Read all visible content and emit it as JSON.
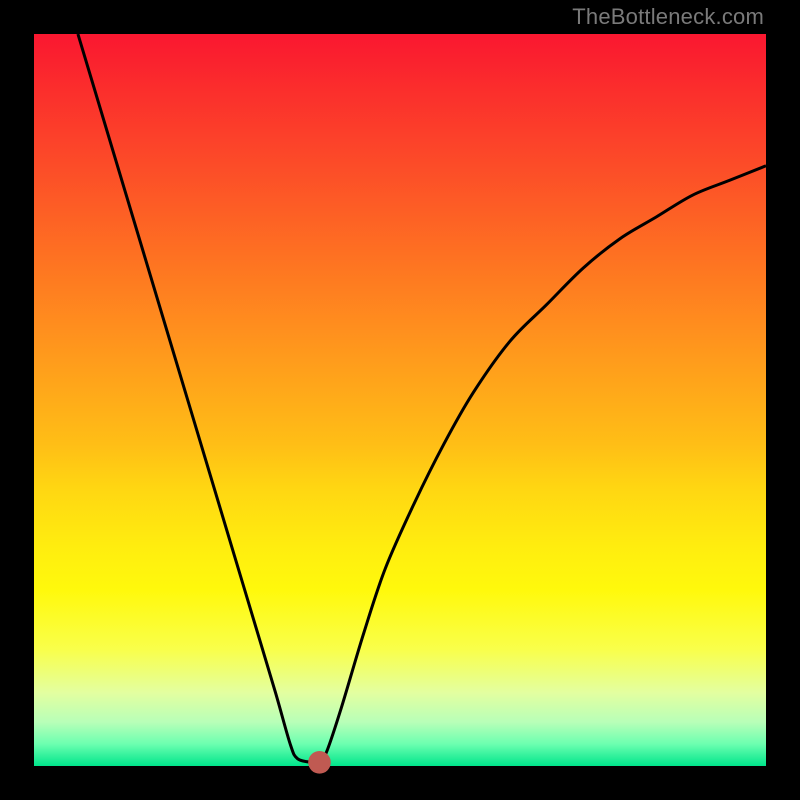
{
  "watermark": {
    "text": "TheBottleneck.com"
  },
  "chart_data": {
    "type": "line",
    "title": "",
    "xlabel": "",
    "ylabel": "",
    "xlim": [
      0,
      100
    ],
    "ylim": [
      0,
      100
    ],
    "curve": [
      {
        "x": 6,
        "y": 100
      },
      {
        "x": 9,
        "y": 90
      },
      {
        "x": 12,
        "y": 80
      },
      {
        "x": 15,
        "y": 70
      },
      {
        "x": 18,
        "y": 60
      },
      {
        "x": 21,
        "y": 50
      },
      {
        "x": 24,
        "y": 40
      },
      {
        "x": 27,
        "y": 30
      },
      {
        "x": 30,
        "y": 20
      },
      {
        "x": 33,
        "y": 10
      },
      {
        "x": 35,
        "y": 3
      },
      {
        "x": 36,
        "y": 1
      },
      {
        "x": 38,
        "y": 0.5
      },
      {
        "x": 39,
        "y": 0.5
      },
      {
        "x": 40,
        "y": 2
      },
      {
        "x": 42,
        "y": 8
      },
      {
        "x": 45,
        "y": 18
      },
      {
        "x": 48,
        "y": 27
      },
      {
        "x": 52,
        "y": 36
      },
      {
        "x": 56,
        "y": 44
      },
      {
        "x": 60,
        "y": 51
      },
      {
        "x": 65,
        "y": 58
      },
      {
        "x": 70,
        "y": 63
      },
      {
        "x": 75,
        "y": 68
      },
      {
        "x": 80,
        "y": 72
      },
      {
        "x": 85,
        "y": 75
      },
      {
        "x": 90,
        "y": 78
      },
      {
        "x": 95,
        "y": 80
      },
      {
        "x": 100,
        "y": 82
      }
    ],
    "marker": {
      "x": 39,
      "y": 0.5,
      "color": "#c05a52",
      "r": 1.0
    },
    "colors": {
      "frame": "#000000",
      "curve": "#000000",
      "gradient_top": "#fa1730",
      "gradient_bottom": "#00e58b"
    }
  }
}
